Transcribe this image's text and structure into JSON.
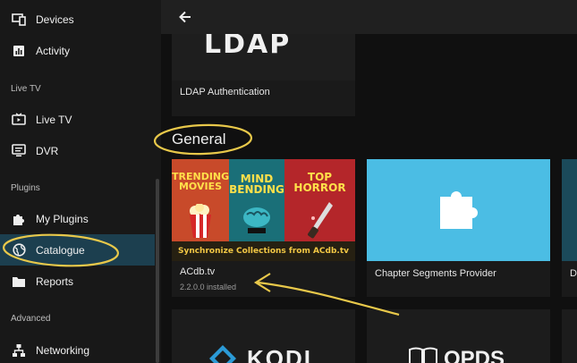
{
  "sidebar": {
    "items": [
      {
        "label": "Devices",
        "icon": "devices-icon"
      },
      {
        "label": "Activity",
        "icon": "activity-icon"
      },
      {
        "label": "Live TV",
        "icon": "live-tv-icon"
      },
      {
        "label": "DVR",
        "icon": "dvr-icon"
      },
      {
        "label": "My Plugins",
        "icon": "puzzle-icon"
      },
      {
        "label": "Catalogue",
        "icon": "globe-icon",
        "active": true
      },
      {
        "label": "Reports",
        "icon": "folder-icon"
      },
      {
        "label": "Networking",
        "icon": "network-icon"
      }
    ],
    "sections": {
      "live_tv": "Live TV",
      "plugins": "Plugins",
      "advanced": "Advanced"
    }
  },
  "main": {
    "section_title": "General",
    "ldap_card": {
      "title": "LDAP Authentication",
      "logo_text": "LDAP"
    },
    "cards": [
      {
        "title": "ACdb.tv",
        "subtitle": "2.2.0.0 installed",
        "banner": "Synchronize Collections from ACdb.tv",
        "posters": [
          "TRENDING MOVIES",
          "MIND BENDING",
          "TOP HORROR"
        ]
      },
      {
        "title": "Chapter Segments Provider"
      },
      {
        "title": "D"
      }
    ],
    "bottom_cards": [
      {
        "logo_text": "KODI"
      },
      {
        "logo_text": "OPDS"
      }
    ]
  },
  "colors": {
    "accent": "#00a4dc",
    "active_nav": "#1c3f4f",
    "chapter_thumb": "#4bbde4",
    "annotation": "#e8c84a"
  }
}
